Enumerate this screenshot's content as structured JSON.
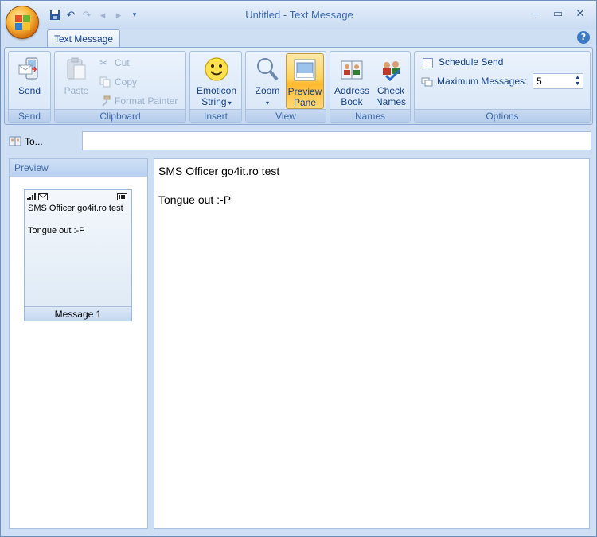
{
  "window": {
    "title": "Untitled - Text Message"
  },
  "ribbon": {
    "active_tab": "Text Message",
    "groups": {
      "send": {
        "label": "Send",
        "send_button": "Send"
      },
      "clipboard": {
        "label": "Clipboard",
        "paste": "Paste",
        "cut": "Cut",
        "copy": "Copy",
        "format_painter": "Format Painter"
      },
      "insert": {
        "label": "Insert",
        "emoticon_line1": "Emoticon",
        "emoticon_line2": "String"
      },
      "view": {
        "label": "View",
        "zoom": "Zoom",
        "preview_line1": "Preview",
        "preview_line2": "Pane"
      },
      "names": {
        "label": "Names",
        "address_line1": "Address",
        "address_line2": "Book",
        "check_line1": "Check",
        "check_line2": "Names"
      },
      "options": {
        "label": "Options",
        "schedule_send": "Schedule Send",
        "maximum_messages_label": "Maximum Messages:",
        "maximum_messages_value": "5"
      }
    }
  },
  "to_button": "To...",
  "preview": {
    "header": "Preview",
    "message_text": "SMS Officer go4it.ro test\n\nTongue out :-P",
    "footer": "Message 1"
  },
  "body_text": "SMS Officer go4it.ro test\n\nTongue out :-P",
  "colors": {
    "accent": "#15428b",
    "ribbon_bg": "#d3e2f5",
    "active_button": "#ffd35c"
  }
}
